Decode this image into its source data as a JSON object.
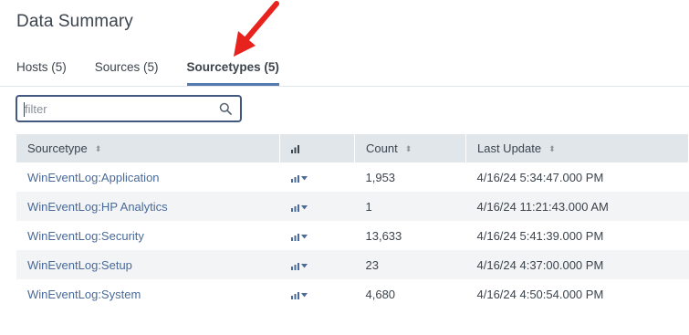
{
  "page": {
    "title": "Data Summary"
  },
  "tabs": [
    {
      "label": "Hosts (5)",
      "active": false
    },
    {
      "label": "Sources (5)",
      "active": false
    },
    {
      "label": "Sourcetypes (5)",
      "active": true
    }
  ],
  "filter": {
    "placeholder": "filter",
    "value": ""
  },
  "table": {
    "headers": {
      "sourcetype": "Sourcetype",
      "count": "Count",
      "last_update": "Last Update"
    },
    "rows": [
      {
        "sourcetype": "WinEventLog:Application",
        "count": "1,953",
        "last_update": "4/16/24 5:34:47.000 PM"
      },
      {
        "sourcetype": "WinEventLog:HP Analytics",
        "count": "1",
        "last_update": "4/16/24 11:21:43.000 AM"
      },
      {
        "sourcetype": "WinEventLog:Security",
        "count": "13,633",
        "last_update": "4/16/24 5:41:39.000 PM"
      },
      {
        "sourcetype": "WinEventLog:Setup",
        "count": "23",
        "last_update": "4/16/24 4:37:00.000 PM"
      },
      {
        "sourcetype": "WinEventLog:System",
        "count": "4,680",
        "last_update": "4/16/24 4:50:54.000 PM"
      }
    ]
  },
  "icons": {
    "sort": "sort-icon",
    "chart": "bar-chart-icon",
    "dropdown": "chevron-down-icon",
    "search": "search-icon",
    "annotation": "red-arrow-icon"
  },
  "colors": {
    "link": "#4a6a9a",
    "tab_active_underline": "#5379af",
    "filter_border": "#41597f",
    "header_bg": "#e1e6eb",
    "alt_row_bg": "#f2f4f5",
    "annotation_arrow": "#e8221c"
  }
}
